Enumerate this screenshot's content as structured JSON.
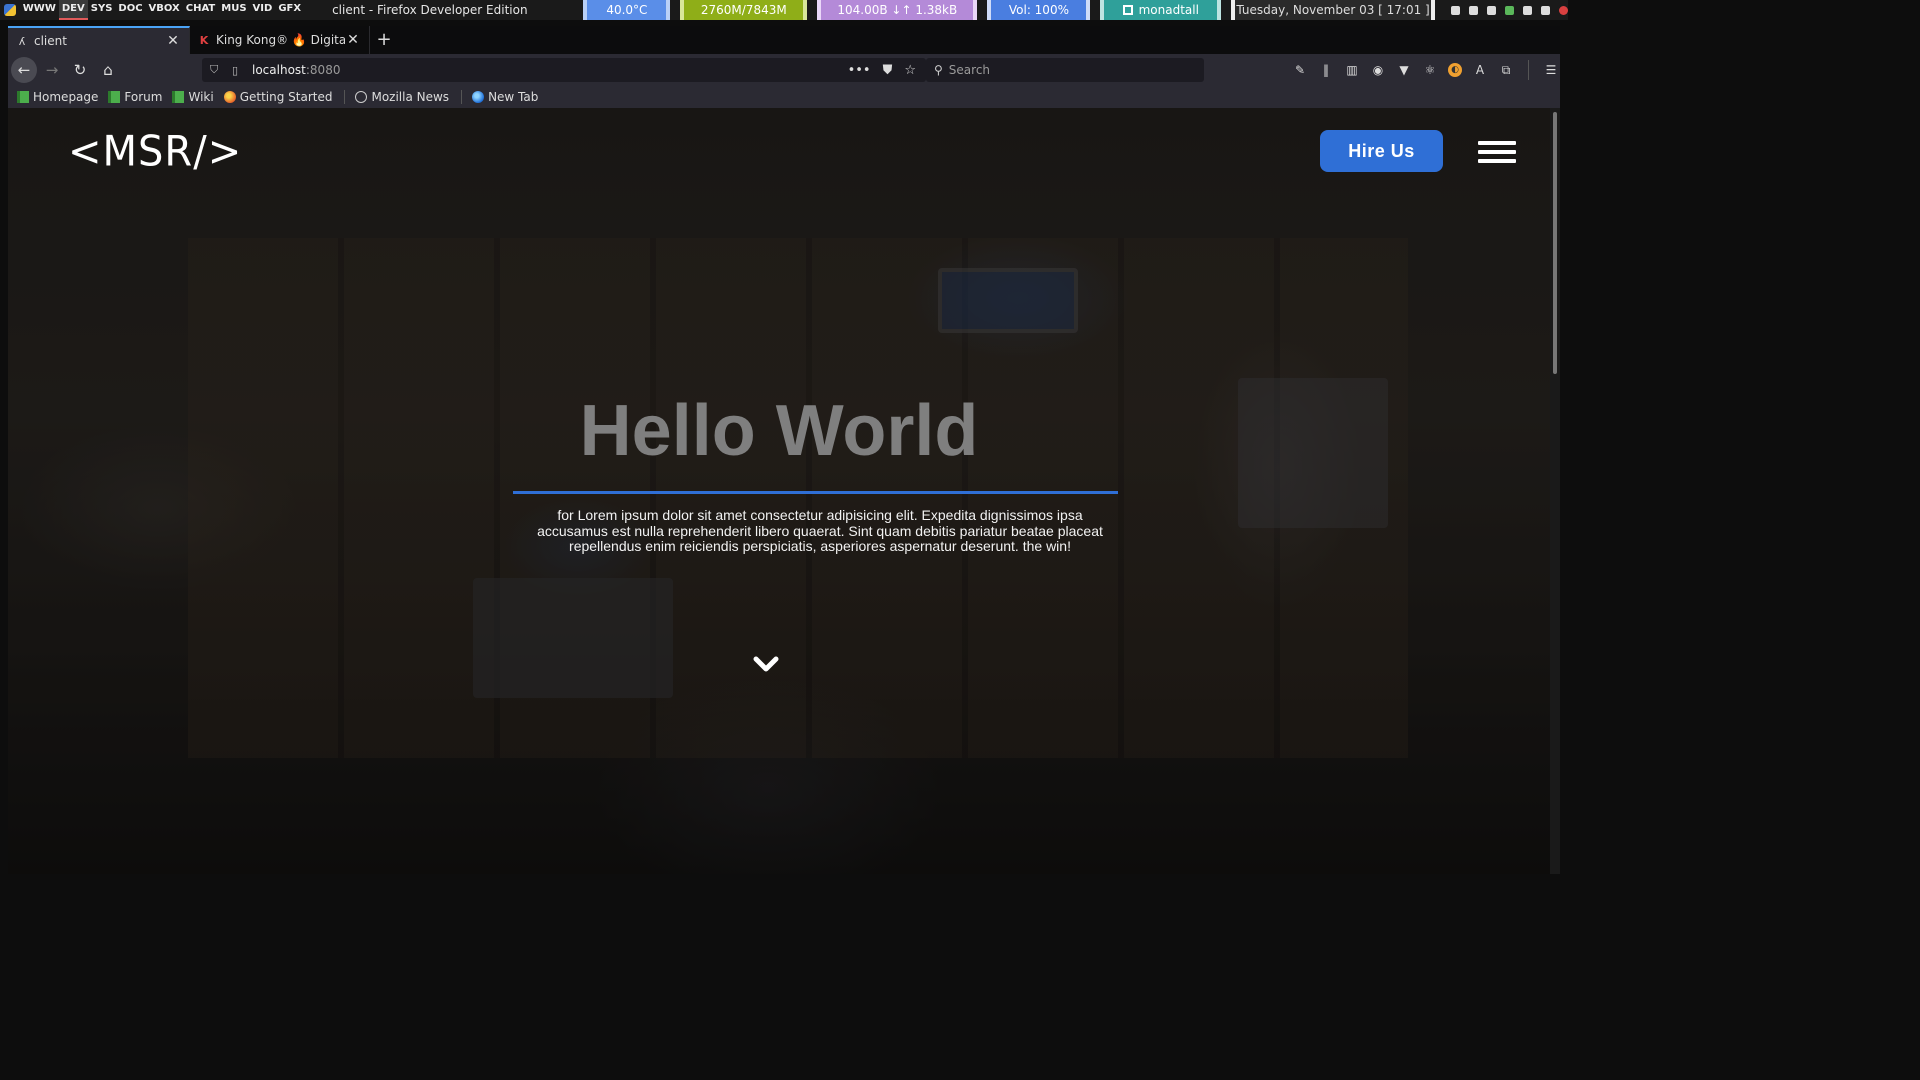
{
  "system_bar": {
    "workspaces": [
      "WWW",
      "DEV",
      "SYS",
      "DOC",
      "VBOX",
      "CHAT",
      "MUS",
      "VID",
      "GFX"
    ],
    "active_workspace": "DEV",
    "window_title": "client - Firefox Developer Edition",
    "temperature": "40.0°C",
    "memory": "2760M/7843M",
    "network": "104.00B ↓↑ 1.38kB",
    "volume": "Vol: 100%",
    "layout": "monadtall",
    "clock": "Tuesday, November 03  [ 17:01 ]"
  },
  "browser": {
    "tabs": [
      {
        "label": "client",
        "active": true,
        "icon": "dev-icon"
      },
      {
        "label": "King Kong® 🔥 Digital D",
        "active": false,
        "icon": "kingkong-icon"
      }
    ],
    "new_tab_label": "+",
    "url_host": "localhost",
    "url_port": ":8080",
    "url_actions": "•••",
    "search_placeholder": "Search",
    "bookmarks": [
      {
        "label": "Homepage",
        "icon": "green"
      },
      {
        "label": "Forum",
        "icon": "green"
      },
      {
        "label": "Wiki",
        "icon": "green"
      },
      {
        "label": "Getting Started",
        "icon": "ff"
      },
      {
        "label": "Mozilla News",
        "icon": "globe"
      },
      {
        "label": "New Tab",
        "icon": "blue"
      }
    ]
  },
  "page": {
    "logo": "<MSR/>",
    "hire_button": "Hire Us",
    "hero_title": "Hello World",
    "hero_text": "for Lorem ipsum dolor sit amet consectetur adipisicing elit. Expedita dignissimos ipsa accusamus est nulla reprehenderit libero quaerat. Sint quam debitis pariatur beatae placeat repellendus enim reiciendis perspiciatis, asperiores aspernatur deserunt. the win!",
    "accent_color": "#2f6fd6"
  }
}
